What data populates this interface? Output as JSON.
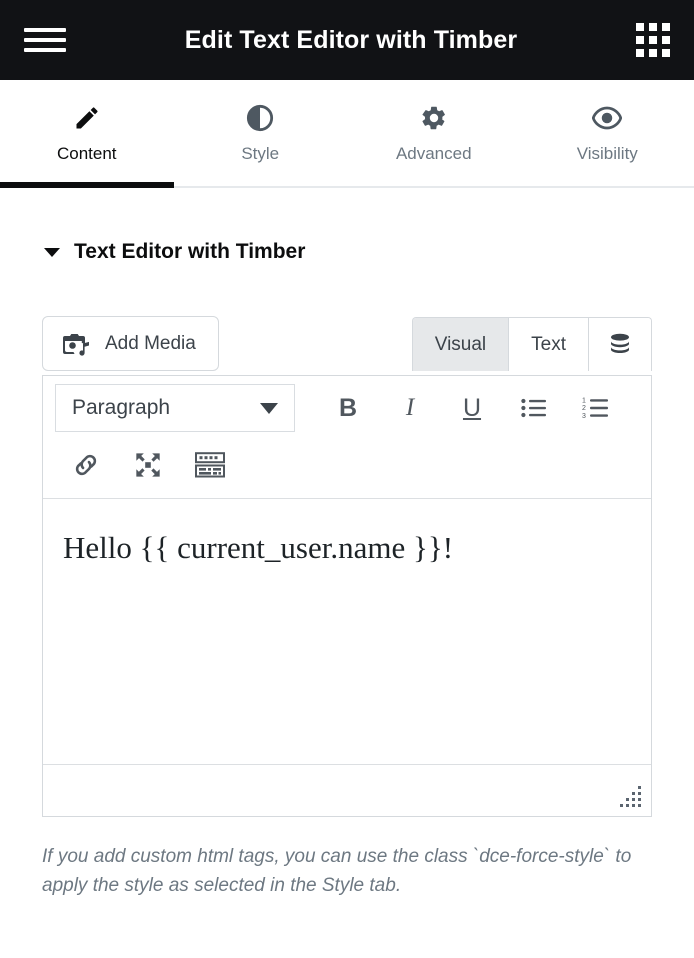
{
  "header": {
    "title": "Edit Text Editor with Timber",
    "menu_icon": "hamburger-icon",
    "apps_icon": "grid-apps-icon",
    "background": "#111215"
  },
  "tabs": [
    {
      "label": "Content",
      "icon": "pencil-icon",
      "active": true
    },
    {
      "label": "Style",
      "icon": "contrast-icon",
      "active": false
    },
    {
      "label": "Advanced",
      "icon": "gear-icon",
      "active": false
    },
    {
      "label": "Visibility",
      "icon": "eye-icon",
      "active": false
    }
  ],
  "section": {
    "title": "Text Editor with Timber",
    "caret": "chevron-down-icon",
    "expanded": true
  },
  "editor": {
    "add_media_label": "Add Media",
    "add_media_icon": "media-camera-note-icon",
    "mode_tabs": [
      {
        "label": "Visual",
        "active": true
      },
      {
        "label": "Text",
        "active": false
      }
    ],
    "database_icon": "database-stack-icon",
    "format_select": {
      "value": "Paragraph",
      "caret": "caret-down-icon"
    },
    "toolbar_row1": [
      {
        "name": "bold-button",
        "glyph": "B"
      },
      {
        "name": "italic-button",
        "glyph": "I"
      },
      {
        "name": "underline-button",
        "glyph": "U"
      },
      {
        "name": "bulleted-list-button",
        "glyph": "ul"
      },
      {
        "name": "numbered-list-button",
        "glyph": "ol"
      }
    ],
    "toolbar_row2": [
      {
        "name": "insert-link-button",
        "glyph": "link"
      },
      {
        "name": "fullscreen-button",
        "glyph": "expand"
      },
      {
        "name": "toolbar-toggle-button",
        "glyph": "keyboard"
      }
    ],
    "content": "Hello {{ current_user.name }}!",
    "resize_handle": "resize-grip-icon"
  },
  "help": {
    "text": "If you add custom html tags, you can use the class `dce-force-style` to apply the style as selected in the Style tab."
  },
  "colors": {
    "header_bg": "#111215",
    "accent_active": "#0c0d0e",
    "muted_text": "#6d7882",
    "border": "#d5d9dd"
  }
}
